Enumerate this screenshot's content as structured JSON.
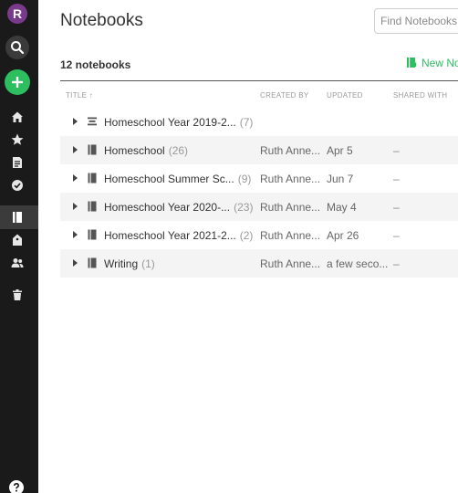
{
  "rail": {
    "avatar_letter": "R",
    "nav": [
      {
        "name": "home-icon"
      },
      {
        "name": "star-icon"
      },
      {
        "name": "note-icon"
      },
      {
        "name": "check-circle-icon"
      },
      {
        "name": "notebook-icon",
        "active": true
      },
      {
        "name": "tag-icon"
      },
      {
        "name": "people-icon"
      },
      {
        "name": "trash-icon"
      }
    ]
  },
  "header": {
    "title": "Notebooks",
    "search_placeholder": "Find Notebooks...",
    "count_label": "12 notebooks",
    "new_notebook_label": "New No"
  },
  "table": {
    "columns": {
      "title": "TITLE ↑",
      "created": "CREATED BY",
      "updated": "UPDATED",
      "shared": "SHARED WITH"
    },
    "rows": [
      {
        "name": "Homeschool Year 2019-2...",
        "count": "(7)",
        "created": "",
        "updated": "",
        "shared": "",
        "icon": "stack"
      },
      {
        "name": "Homeschool",
        "count": "(26)",
        "created": "Ruth Anne...",
        "updated": "Apr 5",
        "shared": "–",
        "icon": "notebook"
      },
      {
        "name": "Homeschool Summer Sc...",
        "count": "(9)",
        "created": "Ruth Anne...",
        "updated": "Jun 7",
        "shared": "–",
        "icon": "notebook"
      },
      {
        "name": "Homeschool Year 2020-...",
        "count": "(23)",
        "created": "Ruth Anne...",
        "updated": "May 4",
        "shared": "–",
        "icon": "notebook"
      },
      {
        "name": "Homeschool Year 2021-2...",
        "count": "(2)",
        "created": "Ruth Anne...",
        "updated": "Apr 26",
        "shared": "–",
        "icon": "notebook"
      },
      {
        "name": "Writing",
        "count": "(1)",
        "created": "Ruth Anne...",
        "updated": "a few seco...",
        "shared": "–",
        "icon": "notebook"
      }
    ]
  },
  "colors": {
    "accent": "#2dbe60",
    "rail": "#1a1a1a"
  }
}
